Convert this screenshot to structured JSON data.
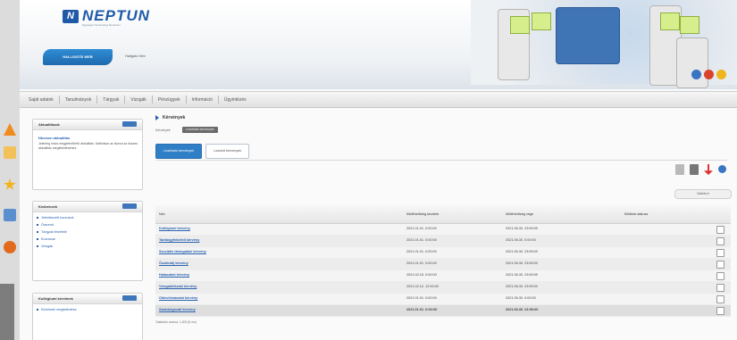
{
  "header": {
    "logo_mark": "N",
    "logo_text": "NEPTUN",
    "logo_sub": "Egységes Tanulmányi Rendszer",
    "mode_button": "HALLGATÓI WEB",
    "user_name": "Hallgató Név"
  },
  "menu": {
    "items": [
      "Saját adatok",
      "Tanulmányok",
      "Tárgyak",
      "Vizsgák",
      "Pénzügyek",
      "Információ",
      "Ügyintézés"
    ]
  },
  "sidebar": {
    "panel1": {
      "title": "Aktualitások",
      "msg_title": "Nincsen aktualitás",
      "msg_text": "Jelenleg nincs megjeleníthető aktualitás. Kattintson az ikonra az összes aktualitás megtekintéséhez."
    },
    "panel2": {
      "title": "Kedvencek",
      "items": [
        "Jelentkezett kurzusok",
        "Órarend",
        "Tárgyak felvétele",
        "Kurzusok",
        "Vizsgák"
      ]
    },
    "panel3": {
      "title": "Kollégiumi kérelmek",
      "items": [
        "Kérelmek megtekintése"
      ]
    }
  },
  "content": {
    "breadcrumb": "Kérvények",
    "sub_label": "Kérvények",
    "sub_pill": "Leadható kérvények",
    "tabs": [
      "Leadható kérvények",
      "Leadott kérvények"
    ],
    "filter_label": "Szűrés ▾",
    "table": {
      "headers": [
        "Név",
        "Kitölthetőség kezdete",
        "Kitölthetőség vége",
        "Kitöltési státusz"
      ],
      "rows": [
        {
          "name": "Kollégiumi kérvény",
          "start": "2021.01.01. 0:00:00",
          "end": "2021.06.30. 23:59:59"
        },
        {
          "name": "Tantárgyfelvételi kérvény",
          "start": "2021.01.01. 0:00:00",
          "end": "2021.06.30. 0:00:00"
        },
        {
          "name": "Szociális támogatási kérvény",
          "start": "2021.01.01. 0:00:00",
          "end": "2021.06.30. 23:59:00"
        },
        {
          "name": "Ösztöndíj kérvény",
          "start": "2021.01.01. 0:00:00",
          "end": "2021.06.30. 23:59:00"
        },
        {
          "name": "Halasztási kérvény",
          "start": "2021.02.15. 0:00:00",
          "end": "2021.06.30. 23:59:59"
        },
        {
          "name": "Vizsgaidőszaki kérvény",
          "start": "2021.02.12. 12:00:00",
          "end": "2021.06.30. 23:59:00"
        },
        {
          "name": "Oklevélmásolat kérvény",
          "start": "2021.01.01. 0:00:00",
          "end": "2021.06.30. 0:00:00"
        },
        {
          "name": "Szakdolgozati kérvény",
          "start": "2021.01.01. 0:00:00",
          "end": "2021.06.30. 23:59:00"
        }
      ],
      "footnote": "Találatok száma: 1-8/8 (8 ms)"
    }
  }
}
